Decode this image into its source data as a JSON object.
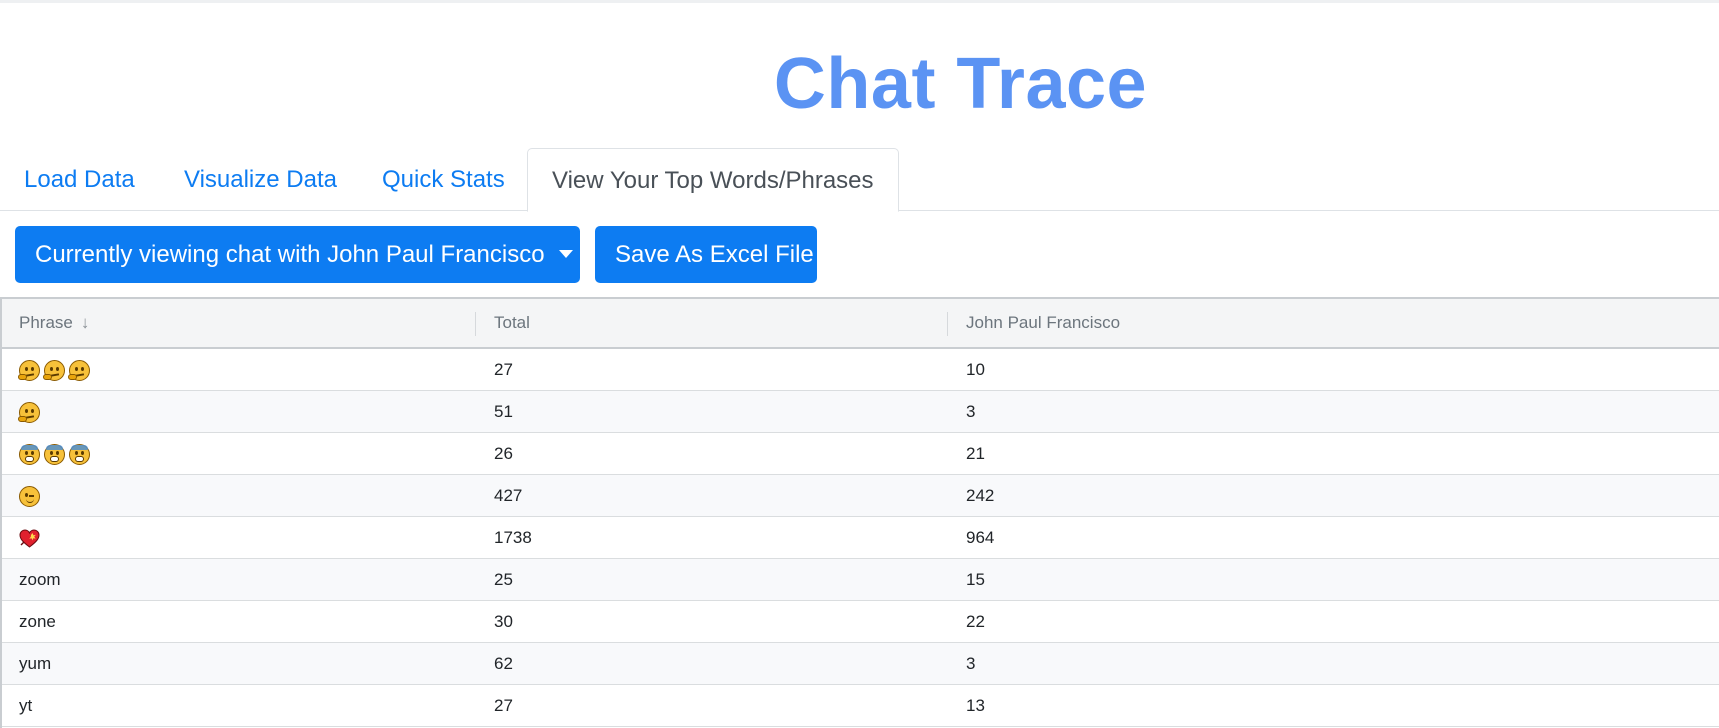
{
  "app": {
    "title": "Chat Trace"
  },
  "tabs": [
    {
      "label": "Load Data",
      "active": false
    },
    {
      "label": "Visualize Data",
      "active": false
    },
    {
      "label": "Quick Stats",
      "active": false
    },
    {
      "label": "View Your Top Words/Phrases",
      "active": true
    }
  ],
  "controls": {
    "chat_select_label": "Currently viewing chat with John Paul Francisco",
    "save_label": "Save As Excel File"
  },
  "table": {
    "columns": [
      "Phrase",
      "Total",
      "John Paul Francisco"
    ],
    "sort": {
      "column": "Phrase",
      "direction": "descending",
      "icon": "arrow-down-icon"
    },
    "rows": [
      {
        "phrase": "",
        "emoji": [
          "thinking-face",
          "thinking-face",
          "thinking-face"
        ],
        "total": "27",
        "person": "10"
      },
      {
        "phrase": "",
        "emoji": [
          "thinking-face"
        ],
        "total": "51",
        "person": "3"
      },
      {
        "phrase": "",
        "emoji": [
          "face-screaming",
          "face-screaming",
          "face-screaming"
        ],
        "total": "26",
        "person": "21"
      },
      {
        "phrase": "",
        "emoji": [
          "winking-face"
        ],
        "total": "427",
        "person": "242"
      },
      {
        "phrase": "",
        "emoji": [
          "heart-with-sparkle"
        ],
        "total": "1738",
        "person": "964"
      },
      {
        "phrase": "zoom",
        "emoji": [],
        "total": "25",
        "person": "15"
      },
      {
        "phrase": "zone",
        "emoji": [],
        "total": "30",
        "person": "22"
      },
      {
        "phrase": "yum",
        "emoji": [],
        "total": "62",
        "person": "3"
      },
      {
        "phrase": "yt",
        "emoji": [],
        "total": "27",
        "person": "13"
      }
    ]
  },
  "colors": {
    "title": "#5b93f3",
    "primary_button": "#0d7cf2",
    "tab_link": "#0d7cf2",
    "header_bg": "#f4f5f6",
    "alt_row_bg": "#f8f9fb"
  }
}
